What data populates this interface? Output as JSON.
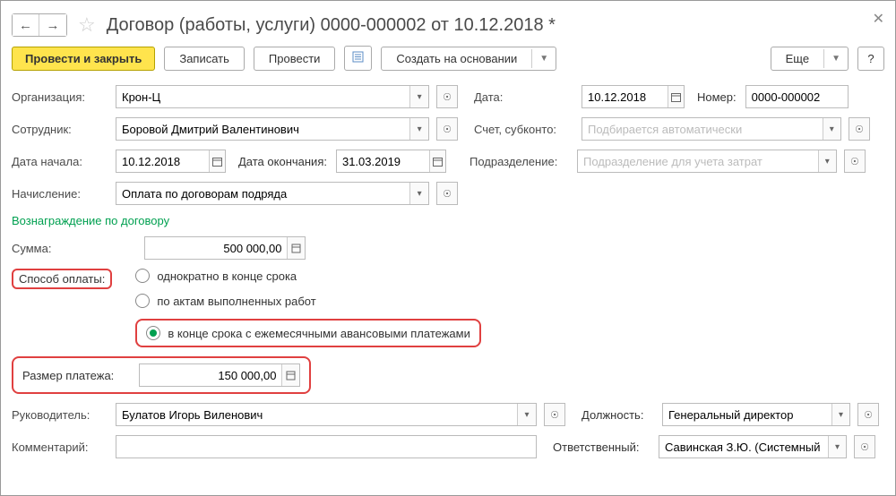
{
  "title": "Договор (работы, услуги) 0000-000002 от 10.12.2018 *",
  "toolbar": {
    "conduct_close": "Провести и закрыть",
    "save": "Записать",
    "conduct": "Провести",
    "create_based": "Создать на основании",
    "more": "Еще",
    "help": "?"
  },
  "labels": {
    "org": "Организация:",
    "date": "Дата:",
    "number": "Номер:",
    "employee": "Сотрудник:",
    "account": "Счет, субконто:",
    "start_date": "Дата начала:",
    "end_date": "Дата окончания:",
    "division": "Подразделение:",
    "accrual": "Начисление:",
    "section": "Вознаграждение по договору",
    "sum": "Сумма:",
    "pay_method": "Способ оплаты:",
    "pay_size": "Размер платежа:",
    "manager": "Руководитель:",
    "position": "Должность:",
    "comment": "Комментарий:",
    "responsible": "Ответственный:"
  },
  "values": {
    "org": "Крон-Ц",
    "date": "10.12.2018",
    "number": "0000-000002",
    "employee": "Боровой Дмитрий Валентинович",
    "account_ph": "Подбирается автоматически",
    "start_date": "10.12.2018",
    "end_date": "31.03.2019",
    "division_ph": "Подразделение для учета затрат",
    "accrual": "Оплата по договорам подряда",
    "sum": "500 000,00",
    "pay_size": "150 000,00",
    "manager": "Булатов Игорь Виленович",
    "position": "Генеральный директор",
    "comment": "",
    "responsible": "Савинская З.Ю. (Системный прог"
  },
  "radios": {
    "r1": "однократно в конце срока",
    "r2": "по актам выполненных работ",
    "r3": "в конце срока с ежемесячными авансовыми платежами"
  }
}
